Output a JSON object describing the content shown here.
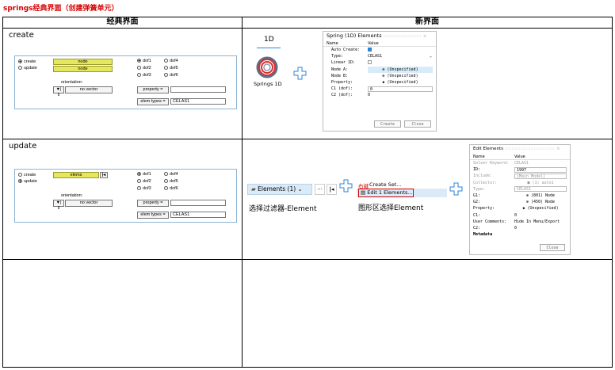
{
  "page_title": "springs经典界面（创建弹簧单元）",
  "headers": {
    "left": "经典界面",
    "right": "新界面"
  },
  "rows": [
    {
      "label": "create"
    },
    {
      "label": "update"
    }
  ],
  "classic_create": {
    "radio_create": "create",
    "radio_update": "update",
    "node1": "node",
    "node2": "node",
    "dof": [
      "dof1",
      "dof4",
      "dof2",
      "dof5",
      "dof3",
      "dof6"
    ],
    "orientation": "orientation:",
    "vector_btn": "no vector",
    "vector_arrows": "▼| ⇕",
    "property": "property =",
    "elem_types": "elem types =",
    "elem_type_value": "CELAS1"
  },
  "classic_update": {
    "radio_create": "create",
    "radio_update": "update",
    "elems": "elems",
    "dof": [
      "dof1",
      "dof4",
      "dof2",
      "dof5",
      "dof3",
      "dof6"
    ],
    "orientation": "orientation:",
    "vector_btn": "no vector",
    "vector_arrows": "▼| ⇕",
    "property": "property =",
    "elem_types": "elem types =",
    "elem_type_value": "CELAS1"
  },
  "new_create": {
    "tab": "1D",
    "icon_label": "Springs 1D",
    "panel_title": "Spring (1D) Elements",
    "panel_dots": ":::::::::::::::::::::: ×",
    "col_name": "Name",
    "col_value": "Value",
    "fields": [
      {
        "k": "Auto Create:",
        "v": ""
      },
      {
        "k": "Type:",
        "v": "CELAS1"
      },
      {
        "k": "Linear 1D:",
        "v": ""
      },
      {
        "k": "Node A:",
        "v": "⊕ (Unspecified)"
      },
      {
        "k": "Node B:",
        "v": "⊕ (Unspecified)"
      },
      {
        "k": "Property:",
        "v": "◆ (Unspecified)"
      },
      {
        "k": "C1 (dof):",
        "v": "0"
      },
      {
        "k": "C2 (dof):",
        "v": "0"
      }
    ],
    "create_btn": "Create",
    "close_btn": "Close"
  },
  "new_update": {
    "selector": "Elements (1) ⌄",
    "more": "···",
    "right_click": "右键",
    "create_set": "Create Set...",
    "edit_elements": "Edit 1 Elements...",
    "caption_left": "选择过滤器-Element",
    "caption_mid": "图形区选择Element",
    "panel_title": "Edit Elements",
    "panel_dots": "::::::::::::::::::::::::::::: ×",
    "col_name": "Name",
    "col_value": "Value",
    "fields": [
      {
        "k": "Solver Keyword:",
        "v": "CELAS1"
      },
      {
        "k": "ID:",
        "v": "1997"
      },
      {
        "k": "Include:",
        "v": "[Main Model]"
      },
      {
        "k": "Collector:",
        "v": "■ (1) auto1"
      },
      {
        "k": "Type:",
        "v": "CELAS1"
      },
      {
        "k": "G1:",
        "v": "⊕ (801) Node"
      },
      {
        "k": "G2:",
        "v": "⊕ (450) Node"
      },
      {
        "k": "Property:",
        "v": "◆ (Unspecified)"
      },
      {
        "k": "C1:",
        "v": "0"
      },
      {
        "k": "User Comments:",
        "v": "Hide In Menu/Export"
      },
      {
        "k": "C2:",
        "v": "0"
      },
      {
        "k": "Metadata",
        "v": ""
      }
    ],
    "close_btn": "Close"
  }
}
